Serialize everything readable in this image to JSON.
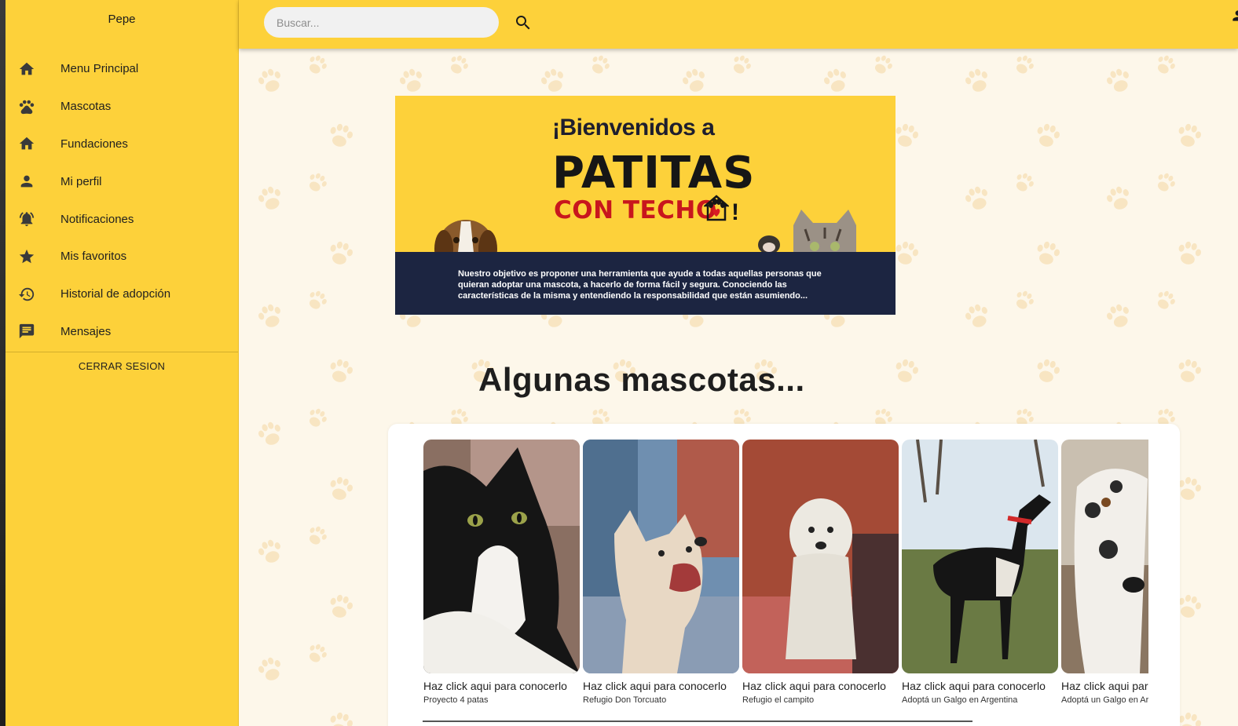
{
  "sidebar": {
    "username": "Pepe",
    "items": [
      {
        "label": "Menu Principal",
        "icon": "home-icon"
      },
      {
        "label": "Mascotas",
        "icon": "paw-icon"
      },
      {
        "label": "Fundaciones",
        "icon": "home-icon"
      },
      {
        "label": "Mi perfil",
        "icon": "person-icon"
      },
      {
        "label": "Notificaciones",
        "icon": "bell-ringing-icon"
      },
      {
        "label": "Mis favoritos",
        "icon": "star-icon"
      },
      {
        "label": "Historial de adopción",
        "icon": "history-icon"
      },
      {
        "label": "Mensajes",
        "icon": "message-icon"
      }
    ],
    "logout_label": "CERRAR SESION"
  },
  "search": {
    "placeholder": "Buscar..."
  },
  "banner": {
    "welcome": "¡Bienvenidos a",
    "brand_main": "PATITAS",
    "brand_sub": "CON TECHO",
    "exclaim": "!",
    "description": "Nuestro objetivo es proponer una herramienta que ayude a todas aquellas personas que quieran adoptar una mascota, a hacerlo de forma fácil y segura. Conociendo las características de la misma y entendiendo la responsabilidad que están asumiendo..."
  },
  "pets_section": {
    "title": "Algunas mascotas...",
    "cards": [
      {
        "title": "Haz click aqui para conocerlo",
        "source": "Proyecto 4 patas",
        "photo": "black-white-cat"
      },
      {
        "title": "Haz click aqui para conocerlo",
        "source": "Refugio Don Torcuato",
        "photo": "cream-dog"
      },
      {
        "title": "Haz click aqui para conocerlo",
        "source": "Refugio el campito",
        "photo": "white-fluffy-dog"
      },
      {
        "title": "Haz click aqui para conocerlo",
        "source": "Adoptá un Galgo en Argentina",
        "photo": "black-greyhound"
      },
      {
        "title": "Haz click aqui para conocerlo",
        "source": "Adoptá un Galgo en Argentina",
        "photo": "spotted-greyhound"
      }
    ]
  },
  "colors": {
    "primary_yellow": "#fdd13a",
    "banner_navy": "#1c2541",
    "brand_red": "#c8161d",
    "background_cream": "#fdf7ea"
  }
}
